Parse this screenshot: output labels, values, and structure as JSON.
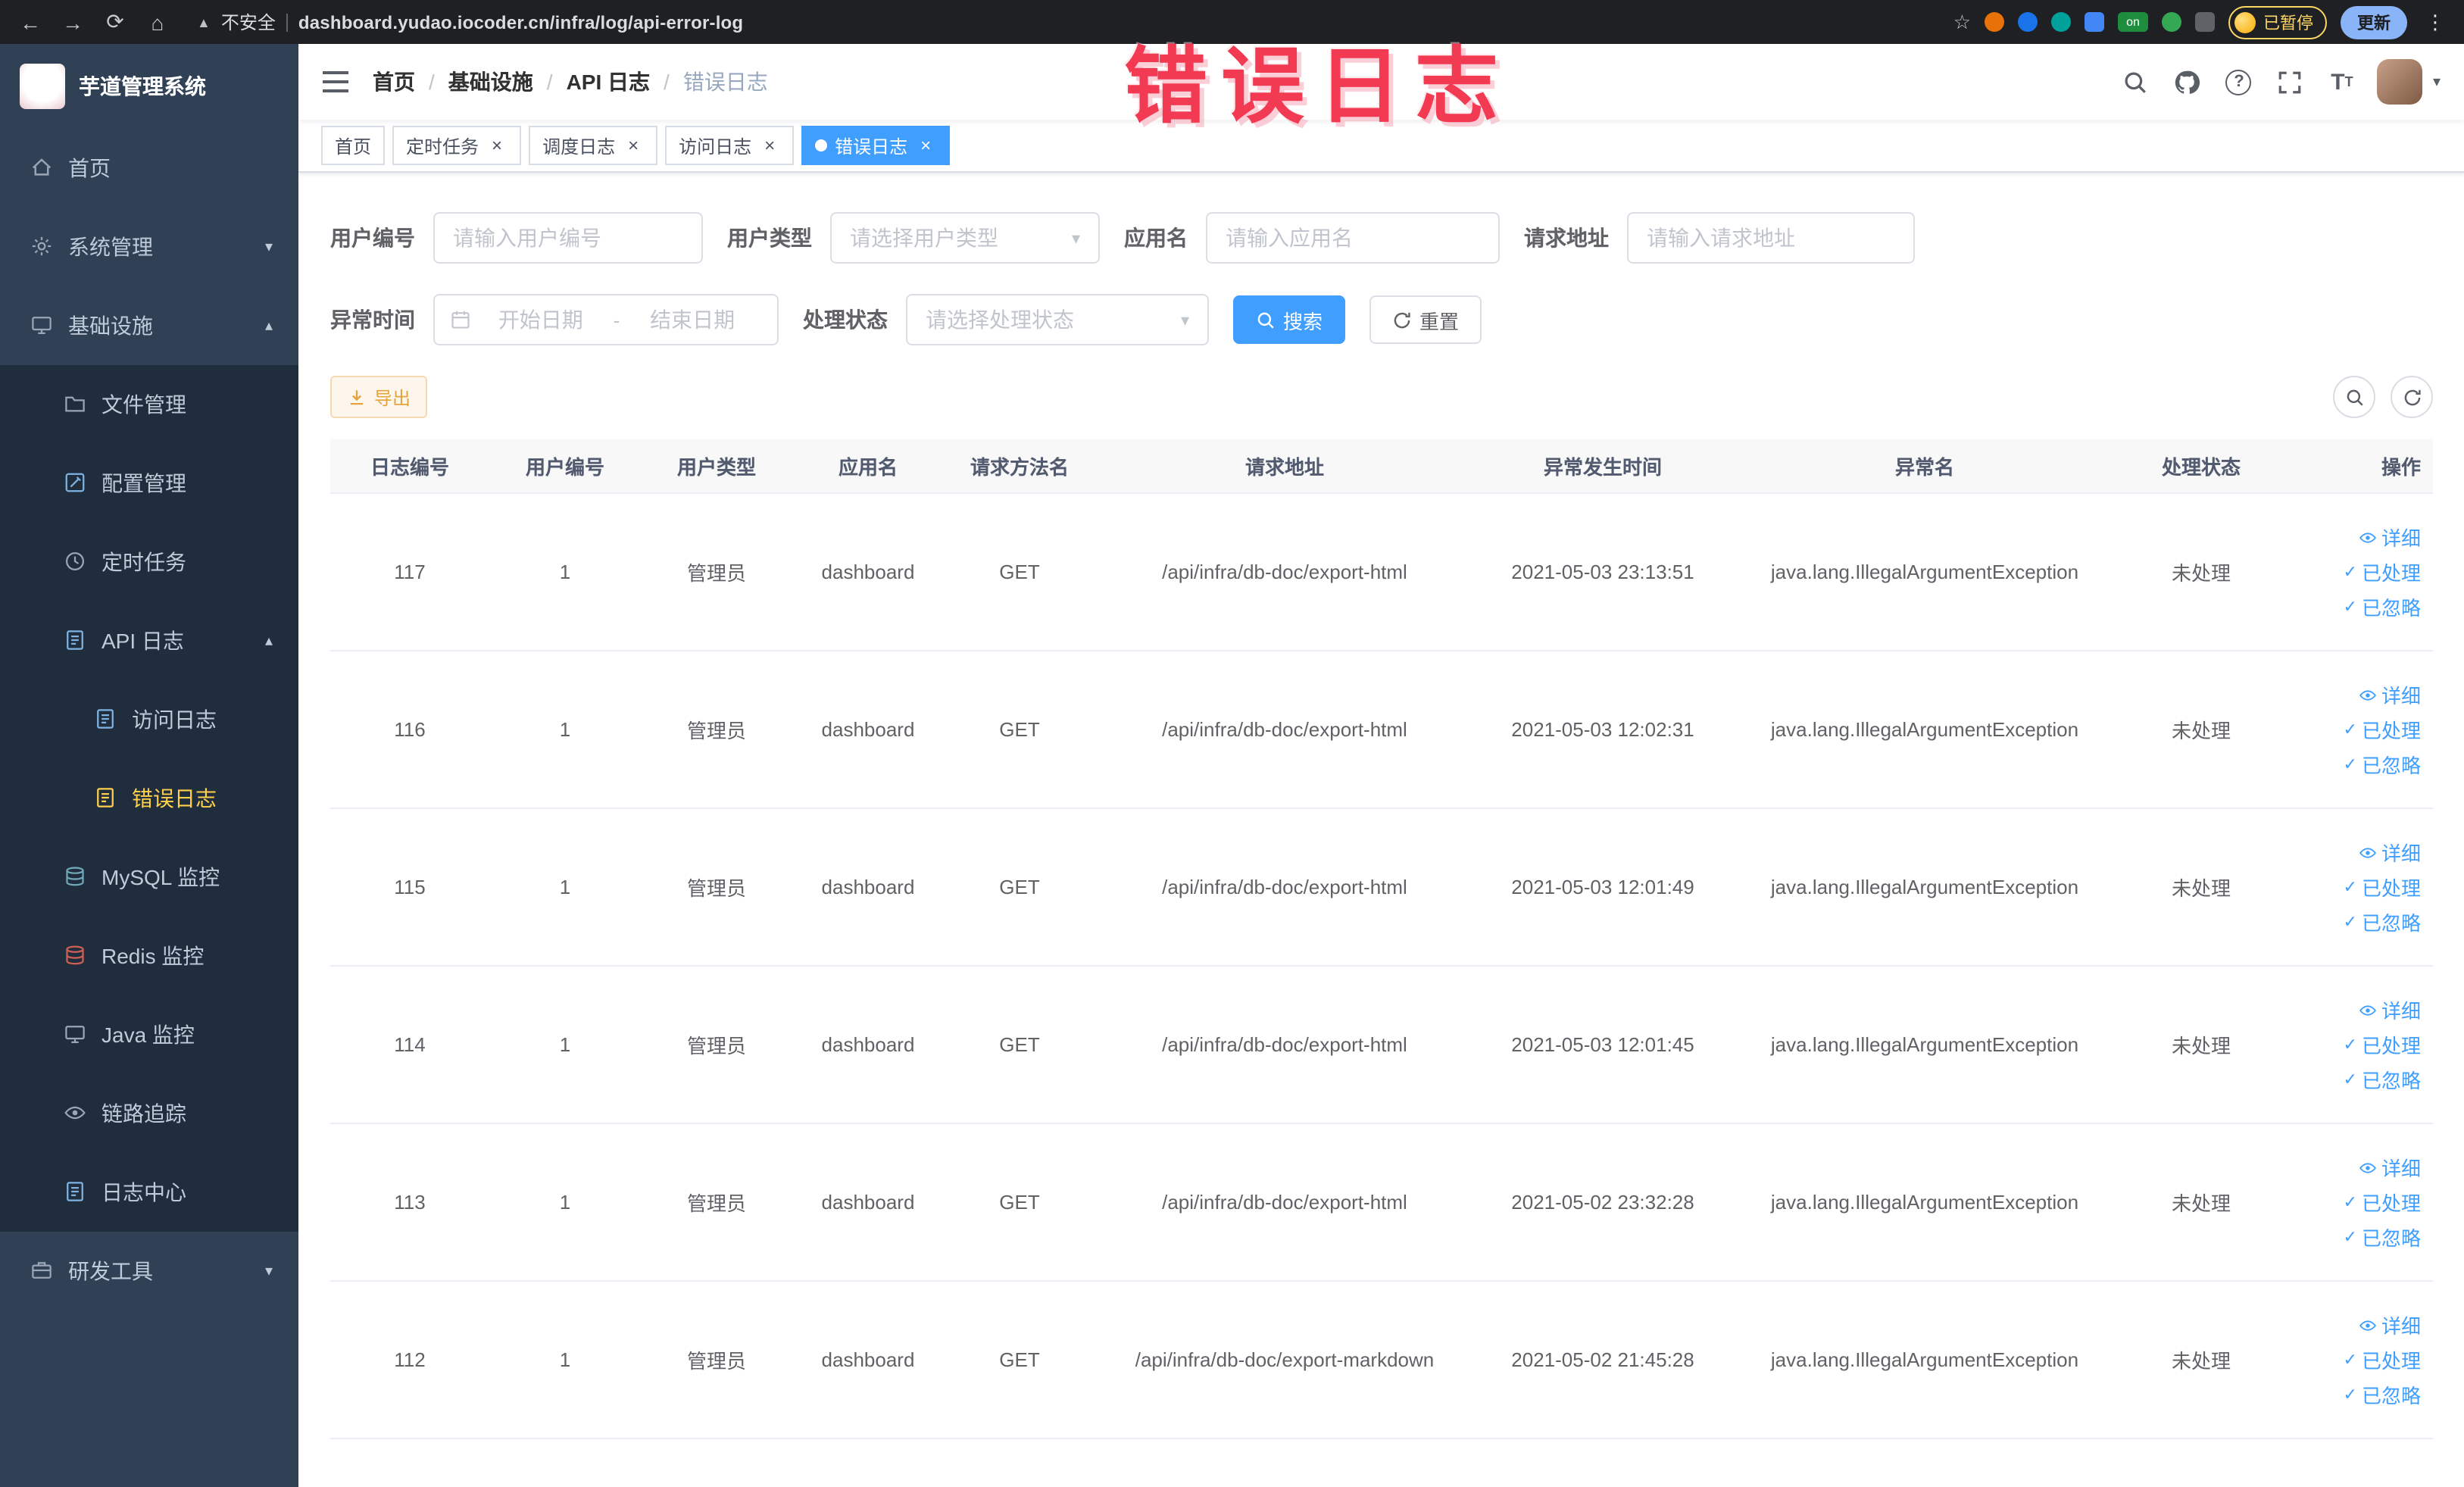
{
  "browser": {
    "security_label": "不安全",
    "url": "dashboard.yudao.iocoder.cn/infra/log/api-error-log",
    "paused_badge": "已暂停",
    "update_button": "更新"
  },
  "watermark": "错误日志",
  "sidebar": {
    "logo_title": "芋道管理系统",
    "items": [
      {
        "label": "首页"
      },
      {
        "label": "系统管理"
      },
      {
        "label": "基础设施"
      },
      {
        "label": "文件管理"
      },
      {
        "label": "配置管理"
      },
      {
        "label": "定时任务"
      },
      {
        "label": "API 日志"
      },
      {
        "label": "访问日志"
      },
      {
        "label": "错误日志"
      },
      {
        "label": "MySQL 监控"
      },
      {
        "label": "Redis 监控"
      },
      {
        "label": "Java 监控"
      },
      {
        "label": "链路追踪"
      },
      {
        "label": "日志中心"
      },
      {
        "label": "研发工具"
      }
    ]
  },
  "navbar": {
    "breadcrumb": [
      "首页",
      "基础设施",
      "API 日志",
      "错误日志"
    ]
  },
  "tags": [
    {
      "label": "首页"
    },
    {
      "label": "定时任务"
    },
    {
      "label": "调度日志"
    },
    {
      "label": "访问日志"
    },
    {
      "label": "错误日志"
    }
  ],
  "filters": {
    "user_id_label": "用户编号",
    "user_id_placeholder": "请输入用户编号",
    "user_type_label": "用户类型",
    "user_type_placeholder": "请选择用户类型",
    "app_name_label": "应用名",
    "app_name_placeholder": "请输入应用名",
    "request_url_label": "请求地址",
    "request_url_placeholder": "请输入请求地址",
    "exception_time_label": "异常时间",
    "start_date_placeholder": "开始日期",
    "range_separator": "-",
    "end_date_placeholder": "结束日期",
    "process_status_label": "处理状态",
    "process_status_placeholder": "请选择处理状态",
    "search_button": "搜索",
    "reset_button": "重置"
  },
  "toolbar": {
    "export_button": "导出"
  },
  "table": {
    "headers": [
      "日志编号",
      "用户编号",
      "用户类型",
      "应用名",
      "请求方法名",
      "请求地址",
      "异常发生时间",
      "异常名",
      "处理状态",
      "操作"
    ],
    "action_detail": "详细",
    "action_processed": "已处理",
    "action_ignored": "已忽略",
    "rows": [
      {
        "log_id": "117",
        "user_id": "1",
        "user_type": "管理员",
        "app_name": "dashboard",
        "method": "GET",
        "request_url": "/api/infra/db-doc/export-html",
        "exception_time": "2021-05-03 23:13:51",
        "exception_name": "java.lang.IllegalArgumentException",
        "status": "未处理"
      },
      {
        "log_id": "116",
        "user_id": "1",
        "user_type": "管理员",
        "app_name": "dashboard",
        "method": "GET",
        "request_url": "/api/infra/db-doc/export-html",
        "exception_time": "2021-05-03 12:02:31",
        "exception_name": "java.lang.IllegalArgumentException",
        "status": "未处理"
      },
      {
        "log_id": "115",
        "user_id": "1",
        "user_type": "管理员",
        "app_name": "dashboard",
        "method": "GET",
        "request_url": "/api/infra/db-doc/export-html",
        "exception_time": "2021-05-03 12:01:49",
        "exception_name": "java.lang.IllegalArgumentException",
        "status": "未处理"
      },
      {
        "log_id": "114",
        "user_id": "1",
        "user_type": "管理员",
        "app_name": "dashboard",
        "method": "GET",
        "request_url": "/api/infra/db-doc/export-html",
        "exception_time": "2021-05-03 12:01:45",
        "exception_name": "java.lang.IllegalArgumentException",
        "status": "未处理"
      },
      {
        "log_id": "113",
        "user_id": "1",
        "user_type": "管理员",
        "app_name": "dashboard",
        "method": "GET",
        "request_url": "/api/infra/db-doc/export-html",
        "exception_time": "2021-05-02 23:32:28",
        "exception_name": "java.lang.IllegalArgumentException",
        "status": "未处理"
      },
      {
        "log_id": "112",
        "user_id": "1",
        "user_type": "管理员",
        "app_name": "dashboard",
        "method": "GET",
        "request_url": "/api/infra/db-doc/export-markdown",
        "exception_time": "2021-05-02 21:45:28",
        "exception_name": "java.lang.IllegalArgumentException",
        "status": "未处理"
      }
    ]
  }
}
